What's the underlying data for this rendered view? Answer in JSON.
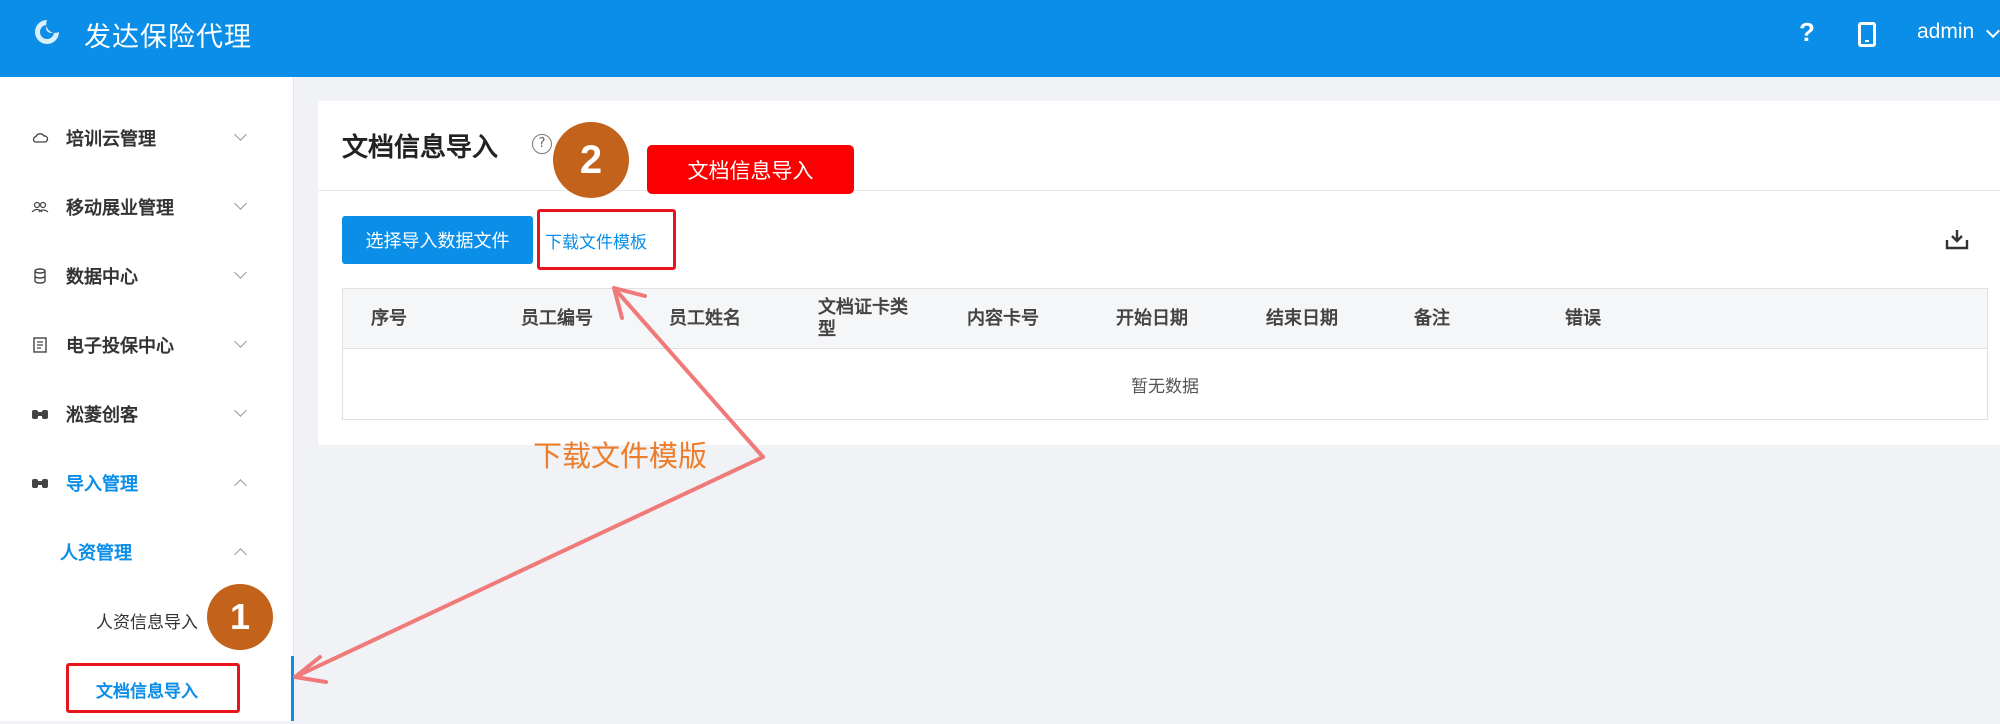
{
  "header": {
    "app_title": "发达保险代理",
    "help_icon": "?",
    "user": "admin"
  },
  "sidebar": {
    "items": [
      {
        "label": "培训云管理",
        "icon": "cloud-icon",
        "expanded": false
      },
      {
        "label": "移动展业管理",
        "icon": "users-icon",
        "expanded": false
      },
      {
        "label": "数据中心",
        "icon": "database-icon",
        "expanded": false
      },
      {
        "label": "电子投保中心",
        "icon": "document-icon",
        "expanded": false
      },
      {
        "label": "淞菱创客",
        "icon": "binoculars-icon",
        "expanded": false
      },
      {
        "label": "导入管理",
        "icon": "binoculars-icon",
        "expanded": true
      }
    ],
    "sub_group": {
      "label": "人资管理",
      "expanded": true
    },
    "sub_items": [
      {
        "label": "人资信息导入",
        "active": false
      },
      {
        "label": "文档信息导入",
        "active": true
      }
    ]
  },
  "main": {
    "title": "文档信息导入",
    "select_button": "选择导入数据文件",
    "download_link": "下载文件模板",
    "table": {
      "columns": [
        "序号",
        "员工编号",
        "员工姓名",
        "文档证卡类型",
        "内容卡号",
        "开始日期",
        "结束日期",
        "备注",
        "错误"
      ],
      "empty_text": "暂无数据"
    }
  },
  "annotations": {
    "badge_1": "1",
    "badge_2": "2",
    "red_label": "文档信息导入",
    "caption": "下载文件模版",
    "colors": {
      "red": "#fb0000",
      "orange": "#ee7d2b",
      "badge": "#c2621b",
      "arrow": "#f07a7a"
    }
  },
  "colors": {
    "brand": "#0a8ee8"
  }
}
